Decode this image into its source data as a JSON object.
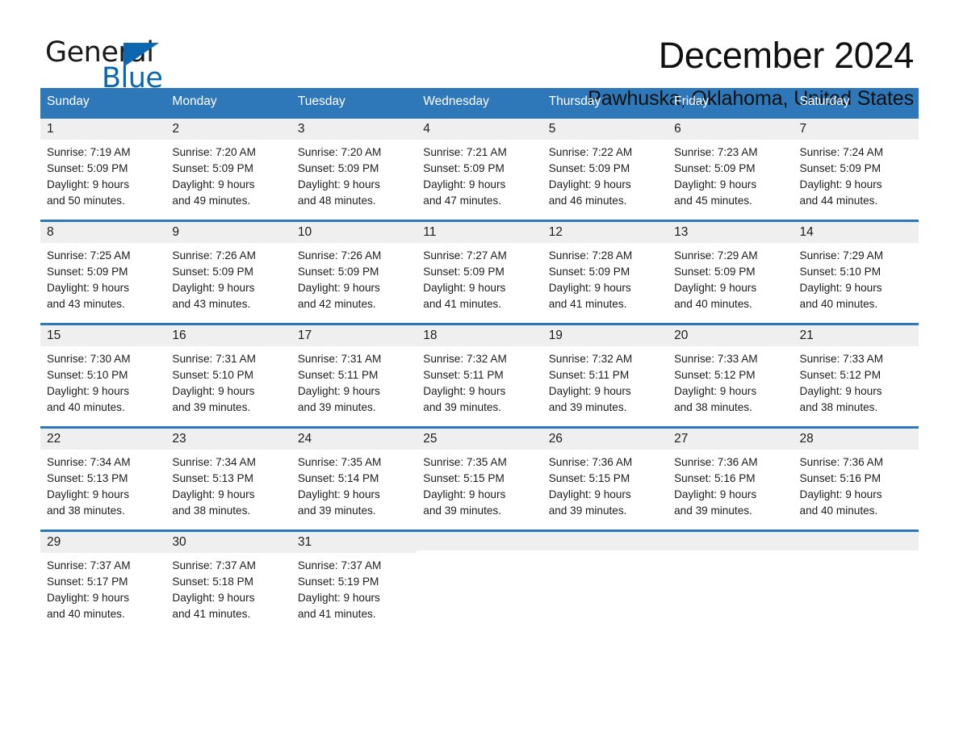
{
  "brand": {
    "name_top": "General",
    "name_bottom": "Blue",
    "accent_color": "#0b68b0"
  },
  "header": {
    "month_title": "December 2024",
    "location": "Pawhuska, Oklahoma, United States"
  },
  "theme": {
    "header_blue": "#2e77b8",
    "daynum_band": "#efefef",
    "text": "#1c1c1c"
  },
  "calendar": {
    "weekday_headers": [
      "Sunday",
      "Monday",
      "Tuesday",
      "Wednesday",
      "Thursday",
      "Friday",
      "Saturday"
    ],
    "weeks": [
      [
        {
          "day": "1",
          "sunrise": "Sunrise: 7:19 AM",
          "sunset": "Sunset: 5:09 PM",
          "daylight_line1": "Daylight: 9 hours",
          "daylight_line2": "and 50 minutes."
        },
        {
          "day": "2",
          "sunrise": "Sunrise: 7:20 AM",
          "sunset": "Sunset: 5:09 PM",
          "daylight_line1": "Daylight: 9 hours",
          "daylight_line2": "and 49 minutes."
        },
        {
          "day": "3",
          "sunrise": "Sunrise: 7:20 AM",
          "sunset": "Sunset: 5:09 PM",
          "daylight_line1": "Daylight: 9 hours",
          "daylight_line2": "and 48 minutes."
        },
        {
          "day": "4",
          "sunrise": "Sunrise: 7:21 AM",
          "sunset": "Sunset: 5:09 PM",
          "daylight_line1": "Daylight: 9 hours",
          "daylight_line2": "and 47 minutes."
        },
        {
          "day": "5",
          "sunrise": "Sunrise: 7:22 AM",
          "sunset": "Sunset: 5:09 PM",
          "daylight_line1": "Daylight: 9 hours",
          "daylight_line2": "and 46 minutes."
        },
        {
          "day": "6",
          "sunrise": "Sunrise: 7:23 AM",
          "sunset": "Sunset: 5:09 PM",
          "daylight_line1": "Daylight: 9 hours",
          "daylight_line2": "and 45 minutes."
        },
        {
          "day": "7",
          "sunrise": "Sunrise: 7:24 AM",
          "sunset": "Sunset: 5:09 PM",
          "daylight_line1": "Daylight: 9 hours",
          "daylight_line2": "and 44 minutes."
        }
      ],
      [
        {
          "day": "8",
          "sunrise": "Sunrise: 7:25 AM",
          "sunset": "Sunset: 5:09 PM",
          "daylight_line1": "Daylight: 9 hours",
          "daylight_line2": "and 43 minutes."
        },
        {
          "day": "9",
          "sunrise": "Sunrise: 7:26 AM",
          "sunset": "Sunset: 5:09 PM",
          "daylight_line1": "Daylight: 9 hours",
          "daylight_line2": "and 43 minutes."
        },
        {
          "day": "10",
          "sunrise": "Sunrise: 7:26 AM",
          "sunset": "Sunset: 5:09 PM",
          "daylight_line1": "Daylight: 9 hours",
          "daylight_line2": "and 42 minutes."
        },
        {
          "day": "11",
          "sunrise": "Sunrise: 7:27 AM",
          "sunset": "Sunset: 5:09 PM",
          "daylight_line1": "Daylight: 9 hours",
          "daylight_line2": "and 41 minutes."
        },
        {
          "day": "12",
          "sunrise": "Sunrise: 7:28 AM",
          "sunset": "Sunset: 5:09 PM",
          "daylight_line1": "Daylight: 9 hours",
          "daylight_line2": "and 41 minutes."
        },
        {
          "day": "13",
          "sunrise": "Sunrise: 7:29 AM",
          "sunset": "Sunset: 5:09 PM",
          "daylight_line1": "Daylight: 9 hours",
          "daylight_line2": "and 40 minutes."
        },
        {
          "day": "14",
          "sunrise": "Sunrise: 7:29 AM",
          "sunset": "Sunset: 5:10 PM",
          "daylight_line1": "Daylight: 9 hours",
          "daylight_line2": "and 40 minutes."
        }
      ],
      [
        {
          "day": "15",
          "sunrise": "Sunrise: 7:30 AM",
          "sunset": "Sunset: 5:10 PM",
          "daylight_line1": "Daylight: 9 hours",
          "daylight_line2": "and 40 minutes."
        },
        {
          "day": "16",
          "sunrise": "Sunrise: 7:31 AM",
          "sunset": "Sunset: 5:10 PM",
          "daylight_line1": "Daylight: 9 hours",
          "daylight_line2": "and 39 minutes."
        },
        {
          "day": "17",
          "sunrise": "Sunrise: 7:31 AM",
          "sunset": "Sunset: 5:11 PM",
          "daylight_line1": "Daylight: 9 hours",
          "daylight_line2": "and 39 minutes."
        },
        {
          "day": "18",
          "sunrise": "Sunrise: 7:32 AM",
          "sunset": "Sunset: 5:11 PM",
          "daylight_line1": "Daylight: 9 hours",
          "daylight_line2": "and 39 minutes."
        },
        {
          "day": "19",
          "sunrise": "Sunrise: 7:32 AM",
          "sunset": "Sunset: 5:11 PM",
          "daylight_line1": "Daylight: 9 hours",
          "daylight_line2": "and 39 minutes."
        },
        {
          "day": "20",
          "sunrise": "Sunrise: 7:33 AM",
          "sunset": "Sunset: 5:12 PM",
          "daylight_line1": "Daylight: 9 hours",
          "daylight_line2": "and 38 minutes."
        },
        {
          "day": "21",
          "sunrise": "Sunrise: 7:33 AM",
          "sunset": "Sunset: 5:12 PM",
          "daylight_line1": "Daylight: 9 hours",
          "daylight_line2": "and 38 minutes."
        }
      ],
      [
        {
          "day": "22",
          "sunrise": "Sunrise: 7:34 AM",
          "sunset": "Sunset: 5:13 PM",
          "daylight_line1": "Daylight: 9 hours",
          "daylight_line2": "and 38 minutes."
        },
        {
          "day": "23",
          "sunrise": "Sunrise: 7:34 AM",
          "sunset": "Sunset: 5:13 PM",
          "daylight_line1": "Daylight: 9 hours",
          "daylight_line2": "and 38 minutes."
        },
        {
          "day": "24",
          "sunrise": "Sunrise: 7:35 AM",
          "sunset": "Sunset: 5:14 PM",
          "daylight_line1": "Daylight: 9 hours",
          "daylight_line2": "and 39 minutes."
        },
        {
          "day": "25",
          "sunrise": "Sunrise: 7:35 AM",
          "sunset": "Sunset: 5:15 PM",
          "daylight_line1": "Daylight: 9 hours",
          "daylight_line2": "and 39 minutes."
        },
        {
          "day": "26",
          "sunrise": "Sunrise: 7:36 AM",
          "sunset": "Sunset: 5:15 PM",
          "daylight_line1": "Daylight: 9 hours",
          "daylight_line2": "and 39 minutes."
        },
        {
          "day": "27",
          "sunrise": "Sunrise: 7:36 AM",
          "sunset": "Sunset: 5:16 PM",
          "daylight_line1": "Daylight: 9 hours",
          "daylight_line2": "and 39 minutes."
        },
        {
          "day": "28",
          "sunrise": "Sunrise: 7:36 AM",
          "sunset": "Sunset: 5:16 PM",
          "daylight_line1": "Daylight: 9 hours",
          "daylight_line2": "and 40 minutes."
        }
      ],
      [
        {
          "day": "29",
          "sunrise": "Sunrise: 7:37 AM",
          "sunset": "Sunset: 5:17 PM",
          "daylight_line1": "Daylight: 9 hours",
          "daylight_line2": "and 40 minutes."
        },
        {
          "day": "30",
          "sunrise": "Sunrise: 7:37 AM",
          "sunset": "Sunset: 5:18 PM",
          "daylight_line1": "Daylight: 9 hours",
          "daylight_line2": "and 41 minutes."
        },
        {
          "day": "31",
          "sunrise": "Sunrise: 7:37 AM",
          "sunset": "Sunset: 5:19 PM",
          "daylight_line1": "Daylight: 9 hours",
          "daylight_line2": "and 41 minutes."
        },
        {
          "day": "",
          "sunrise": "",
          "sunset": "",
          "daylight_line1": "",
          "daylight_line2": ""
        },
        {
          "day": "",
          "sunrise": "",
          "sunset": "",
          "daylight_line1": "",
          "daylight_line2": ""
        },
        {
          "day": "",
          "sunrise": "",
          "sunset": "",
          "daylight_line1": "",
          "daylight_line2": ""
        },
        {
          "day": "",
          "sunrise": "",
          "sunset": "",
          "daylight_line1": "",
          "daylight_line2": ""
        }
      ]
    ]
  }
}
